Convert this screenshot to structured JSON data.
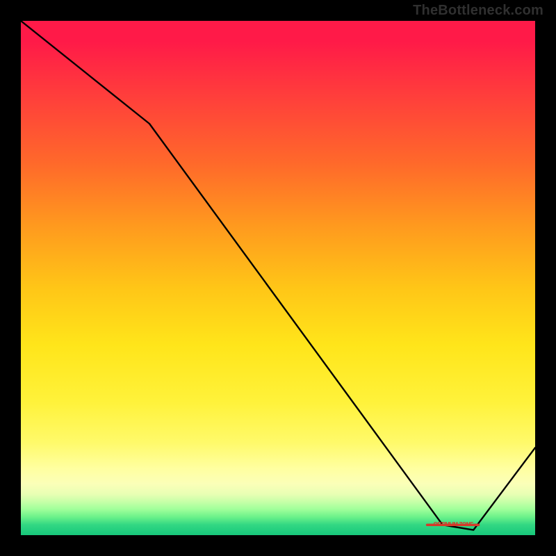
{
  "watermark": "TheBottleneck.com",
  "chart_data": {
    "type": "line",
    "title": "",
    "xlabel": "",
    "ylabel": "",
    "xlim": [
      0,
      100
    ],
    "ylim": [
      0,
      100
    ],
    "x": [
      0,
      25,
      82,
      88,
      100
    ],
    "values": [
      100,
      80,
      2,
      1,
      17
    ],
    "marker": {
      "x_range": [
        79,
        89
      ],
      "y": 2,
      "label": "OPTIMUM ZONE"
    },
    "colors": {
      "gradient_top": "#ff1a48",
      "gradient_mid": "#ffe51a",
      "gradient_bottom": "#17c87b",
      "curve": "#000000",
      "marker_label": "#d43a2a",
      "frame": "#000000"
    }
  }
}
